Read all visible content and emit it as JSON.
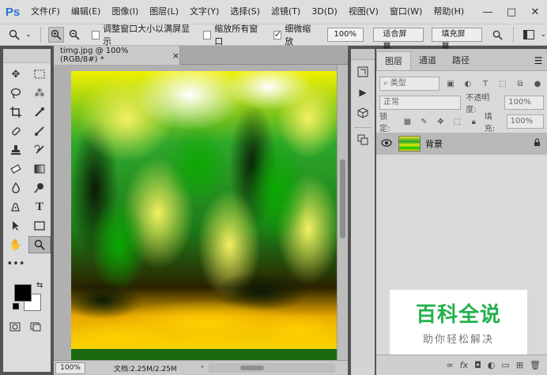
{
  "app": {
    "logo": "Ps"
  },
  "menu": [
    "文件(F)",
    "编辑(E)",
    "图像(I)",
    "图层(L)",
    "文字(Y)",
    "选择(S)",
    "滤镜(T)",
    "3D(D)",
    "视图(V)",
    "窗口(W)",
    "帮助(H)"
  ],
  "window_buttons": {
    "minimize": "—",
    "maximize": "□",
    "close": "✕"
  },
  "options": {
    "resize_windows": "调整窗口大小以满屏显示",
    "zoom_all": "缩放所有窗口",
    "scrubby_zoom": "细微缩放",
    "zoom_value": "100%",
    "fit_screen": "适合屏幕",
    "fill_screen": "填充屏幕",
    "resize_checked": false,
    "zoom_all_checked": false,
    "scrubby_checked": true
  },
  "document": {
    "tab_title": "timg.jpg @ 100%(RGB/8#) *",
    "close_glyph": "×",
    "status_zoom": "100%",
    "status_doc": "文档:2.25M/2.25M"
  },
  "layers": {
    "tabs": [
      "图层",
      "通道",
      "路径"
    ],
    "filter_kind": "类型",
    "blend_mode": "正常",
    "opacity_label": "不透明度:",
    "opacity_value": "100%",
    "lock_label": "锁定:",
    "fill_label": "填充:",
    "fill_value": "100%",
    "layer_name": "背景"
  },
  "watermark": {
    "title": "百科全说",
    "subtitle": "助你轻松解决"
  }
}
